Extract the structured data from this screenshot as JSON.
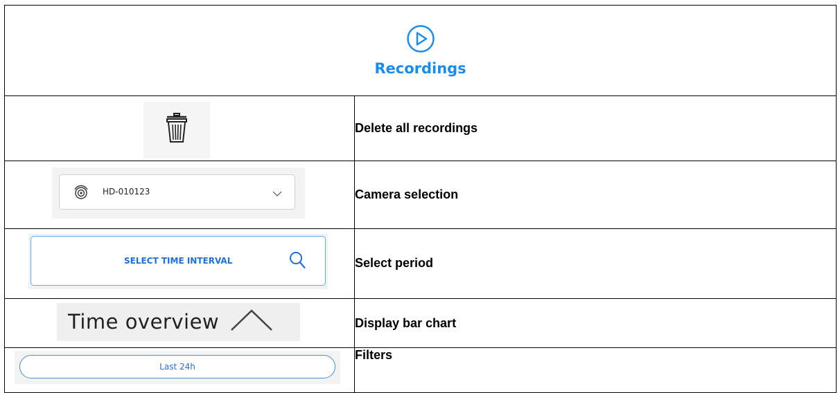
{
  "header": {
    "icon": "play-circle-icon",
    "title": "Recordings",
    "accent_color": "#1a8cf0"
  },
  "rows": [
    {
      "icon": "trash-icon",
      "description": "Delete all recordings"
    },
    {
      "icon": "camera-icon",
      "camera_name": "HD-010123",
      "description": "Camera selection"
    },
    {
      "button_label": "SELECT TIME INTERVAL",
      "icon": "search-icon",
      "description": "Select period"
    },
    {
      "label": "Time overview",
      "icon": "chevron-up-icon",
      "description": "Display bar chart"
    },
    {
      "filter_label": "Last 24h",
      "description": "Filters"
    }
  ]
}
